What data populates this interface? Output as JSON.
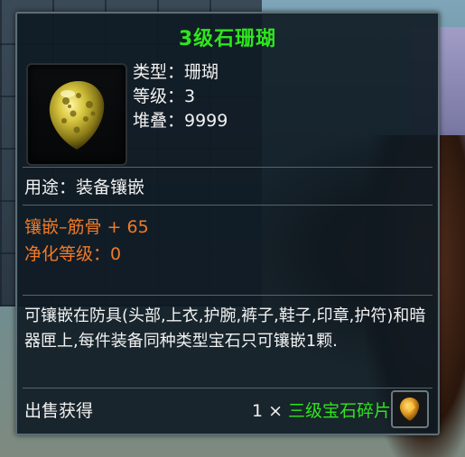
{
  "tooltip": {
    "title": "3级石珊瑚",
    "type_line": "类型：珊瑚",
    "level_line": "等级：3",
    "stack_line": "堆叠：9999",
    "usage_line": "用途：装备镶嵌",
    "stats": [
      "镶嵌–筋骨 + 65",
      "净化等级：0"
    ],
    "description": "可镶嵌在防具(头部,上衣,护腕,裤子,鞋子,印章,护符)和暗器匣上,每件装备同种类型宝石只可镶嵌1颗.",
    "sell": {
      "label": "出售获得",
      "quantity": "1",
      "times": "×",
      "item": "三级宝石碎片",
      "icon": "gem-fragment-icon"
    },
    "item_icon": "coral-stone-icon"
  },
  "colors": {
    "title_green": "#2ee61c",
    "stat_orange": "#f07a28",
    "text_white": "#f1f1f1"
  }
}
